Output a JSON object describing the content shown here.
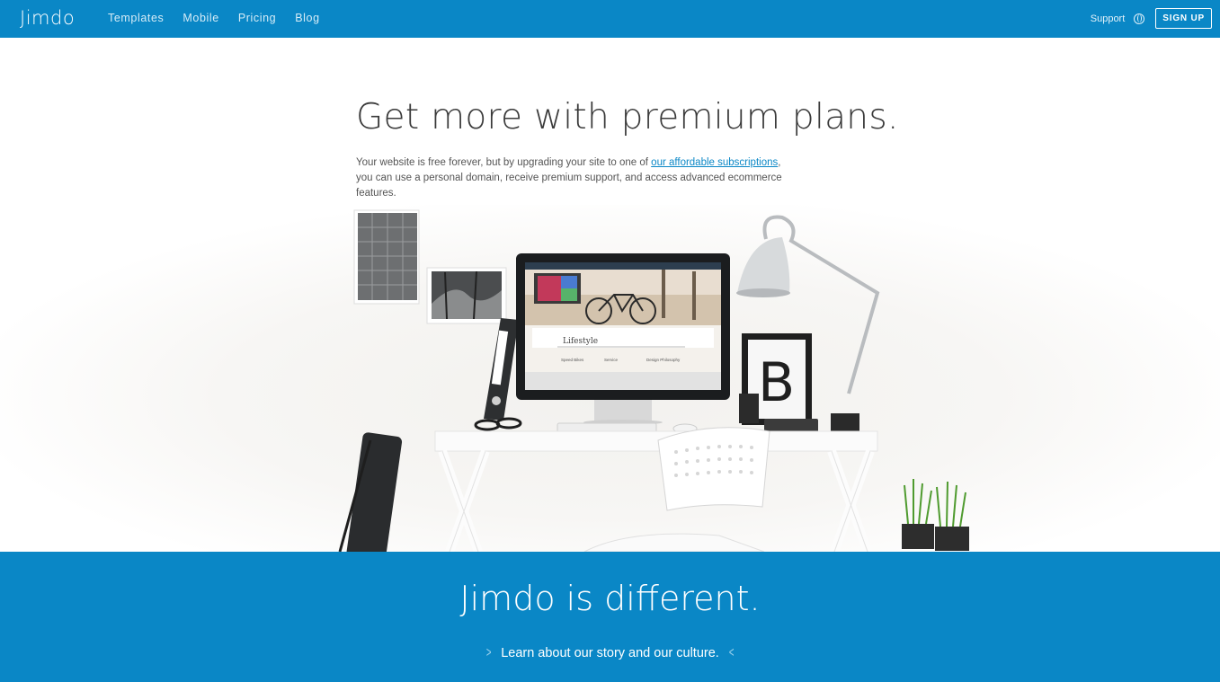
{
  "header": {
    "logo": "Jimdo",
    "nav": [
      "Templates",
      "Mobile",
      "Pricing",
      "Blog"
    ],
    "support": "Support",
    "signup": "SIGN UP"
  },
  "hero": {
    "title": "Get more with premium plans.",
    "text_before": "Your website is free forever, but by upgrading your site to one of ",
    "link": "our affordable subscriptions",
    "text_after": ", you can use a personal domain, receive premium support, and access advanced ecommerce features."
  },
  "screen": {
    "site_title": "Lifestyle",
    "columns": [
      "Speed Bikes",
      "Service",
      "Design Philosophy"
    ]
  },
  "band": {
    "title": "Jimdo is different.",
    "link": "Learn about our story and our culture."
  },
  "colors": {
    "brand_blue": "#0a87c6",
    "text": "#3a3a3a"
  },
  "icons": [
    "globe-icon",
    "chevron-right-icon",
    "chevron-left-icon"
  ]
}
